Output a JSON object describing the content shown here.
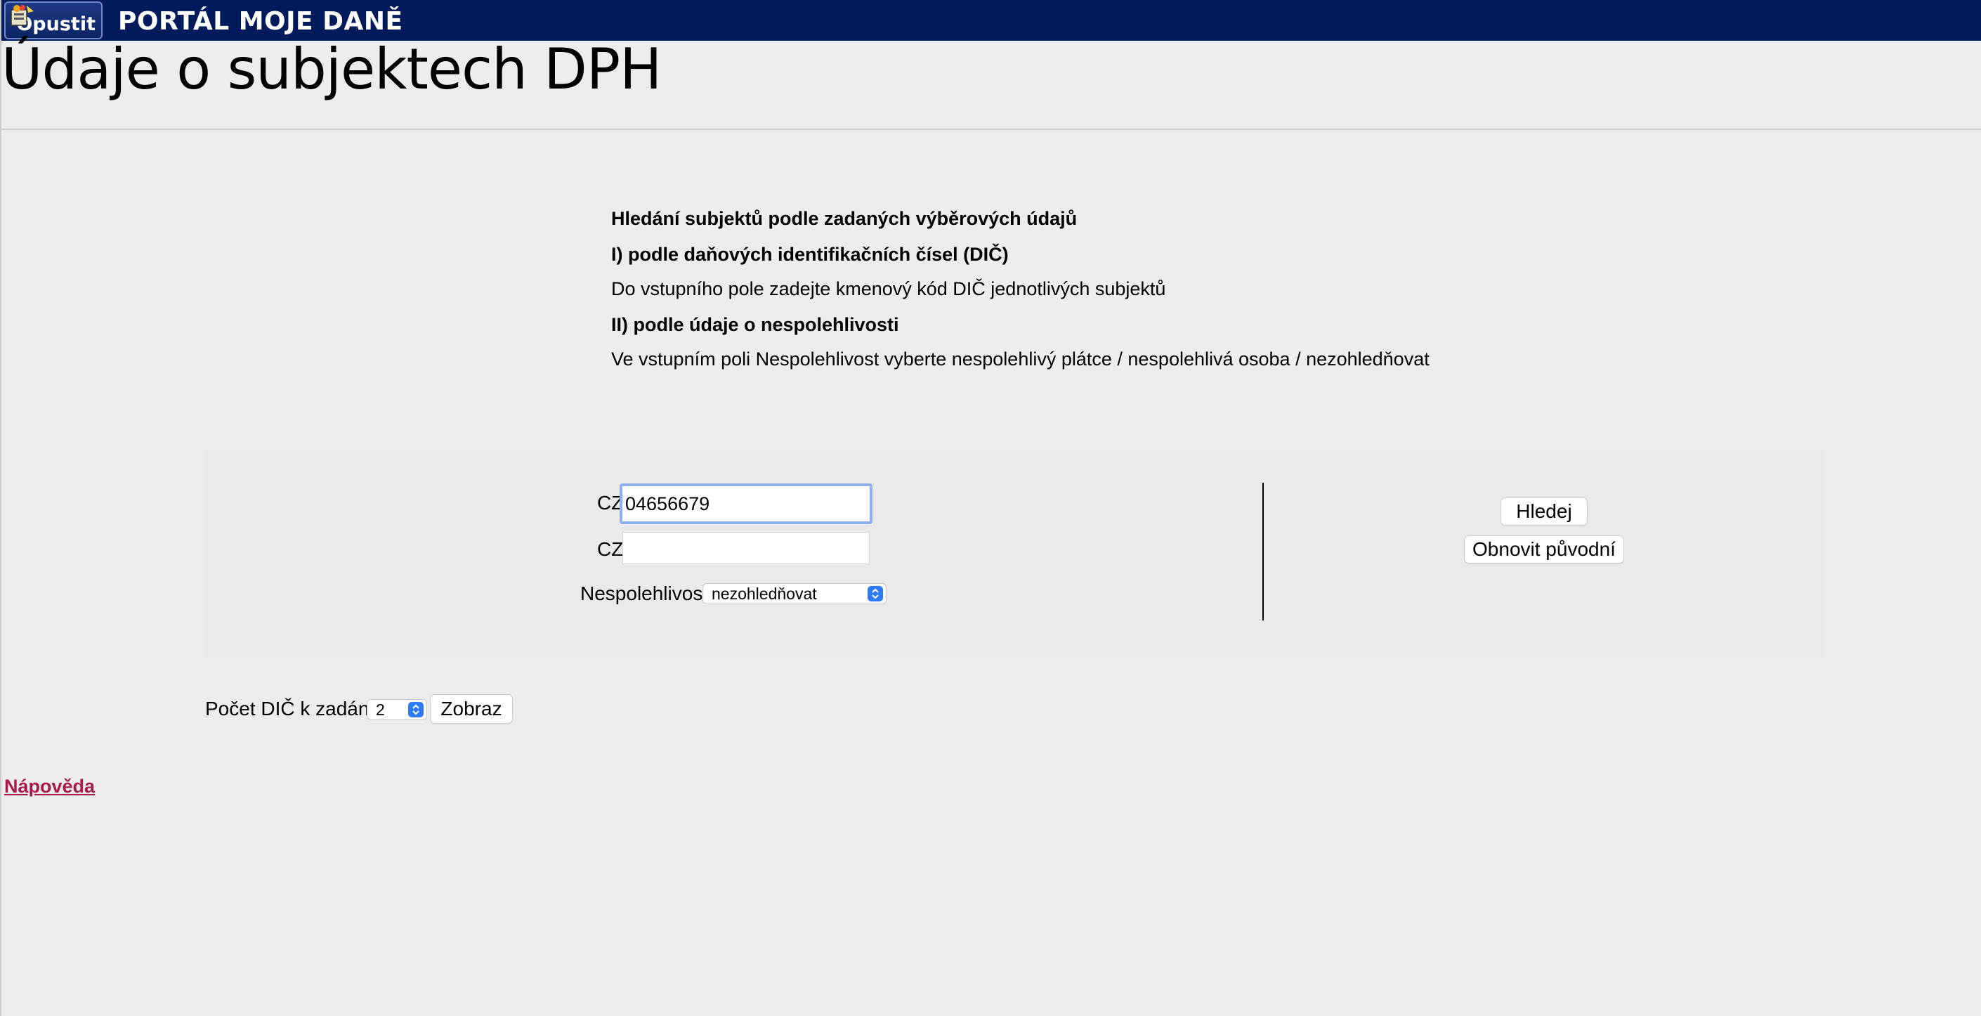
{
  "header": {
    "exit_label": "Opustit",
    "portal_title": "PORTÁL MOJE DANĚ",
    "brand_color": "#001a5c"
  },
  "page": {
    "title": "Údaje o subjektech DPH"
  },
  "info": {
    "heading": "Hledání subjektů podle zadaných výběrových údajů",
    "section1_title": "I) podle daňových identifikačních čísel (DIČ)",
    "section1_text": "Do vstupního pole zadejte kmenový kód DIČ jednotlivých subjektů",
    "section2_title": "II) podle údaje o nespolehlivosti",
    "section2_text": "Ve vstupním poli Nespolehlivost vyberte nespolehlivý plátce / nespolehlivá osoba / nezohledňovat"
  },
  "search": {
    "dic_prefix_1": "CZ",
    "dic_value_1": "04656679",
    "dic_prefix_2": "CZ",
    "dic_value_2": "",
    "unreliability_label": "Nespolehlivost",
    "unreliability_selected": "nezohledňovat",
    "search_button": "Hledej",
    "reset_button": "Obnovit původní"
  },
  "count": {
    "label": "Počet DIČ k zadání:",
    "selected": "2",
    "show_button": "Zobraz"
  },
  "footer": {
    "help_link": "Nápověda",
    "link_color": "#a8194c"
  }
}
